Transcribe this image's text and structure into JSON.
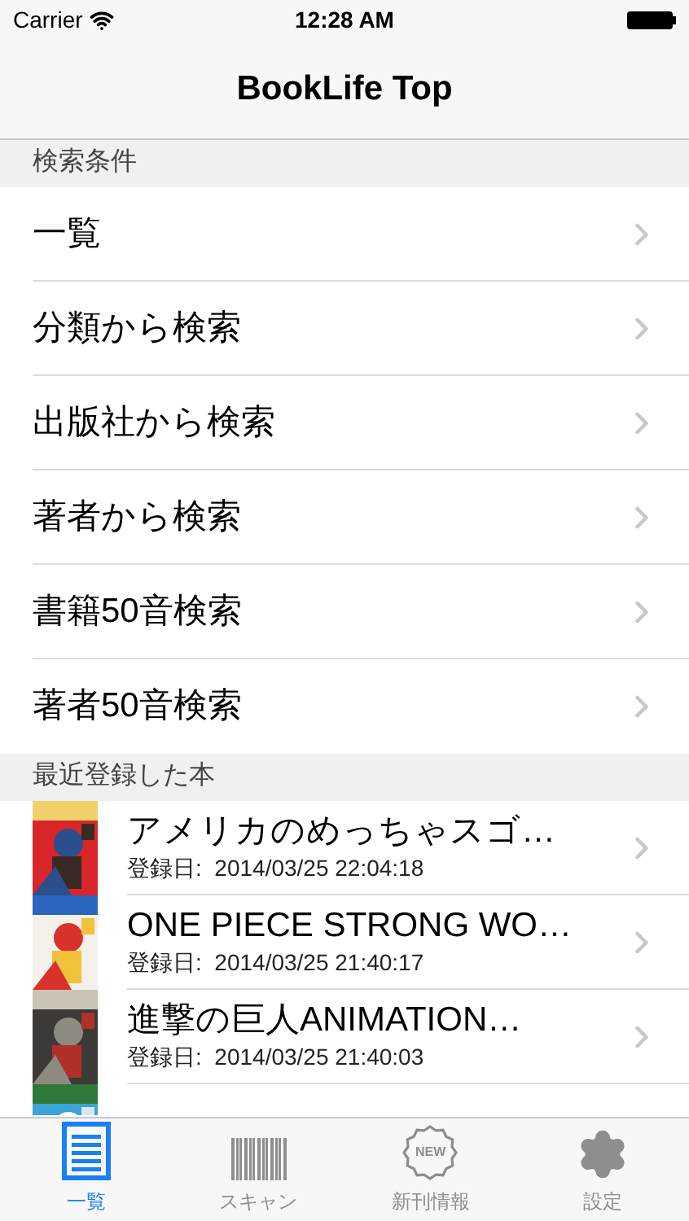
{
  "status_bar": {
    "carrier": "Carrier",
    "time": "12:28 AM"
  },
  "nav_bar": {
    "title": "BookLife Top"
  },
  "search_section": {
    "header": "検索条件",
    "items": [
      {
        "label": "一覧"
      },
      {
        "label": "分類から検索"
      },
      {
        "label": "出版社から検索"
      },
      {
        "label": "著者から検索"
      },
      {
        "label": "書籍50音検索"
      },
      {
        "label": "著者50音検索"
      }
    ]
  },
  "recent_section": {
    "header": "最近登録した本",
    "books": [
      {
        "title": "アメリカのめっちゃスゴ…",
        "date": "登録日:  2014/03/25 22:04:18",
        "cover": {
          "kind": "picture"
        }
      },
      {
        "title": "ONE PIECE STRONG WO…",
        "date": "登録日:  2014/03/25 21:40:17",
        "cover": {
          "kind": "picture"
        }
      },
      {
        "title": "進撃の巨人ANIMATION…",
        "date": "登録日:  2014/03/25 21:40:03",
        "cover": {
          "kind": "picture"
        }
      },
      {
        "cover": {
          "kind": "picture"
        }
      }
    ]
  },
  "tab_bar": [
    {
      "label": "一覧",
      "kind": "list",
      "selected": true
    },
    {
      "label": "スキャン",
      "kind": "barcode",
      "selected": false
    },
    {
      "label": "新刊情報",
      "kind": "new",
      "badge_text": "NEW",
      "selected": false
    },
    {
      "label": "設定",
      "kind": "settings",
      "selected": false
    }
  ]
}
